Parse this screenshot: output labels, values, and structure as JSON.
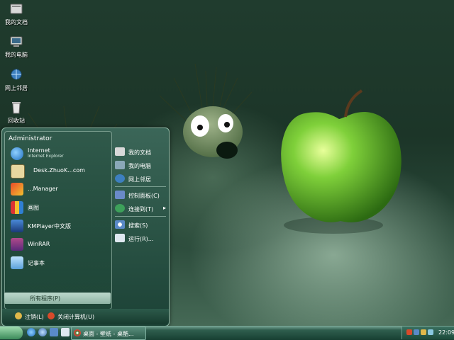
{
  "desktop": {
    "icons": [
      {
        "label": "我的文档",
        "icon": "my-documents-icon"
      },
      {
        "label": "我的电脑",
        "icon": "my-computer-icon"
      },
      {
        "label": "网上邻居",
        "icon": "network-places-icon"
      },
      {
        "label": "回收站",
        "icon": "recycle-bin-icon"
      }
    ]
  },
  "start_menu": {
    "user": "Administrator",
    "programs": [
      {
        "label": "Internet",
        "sublabel": "Internet Explorer",
        "icon": "internet-explorer-icon"
      },
      {
        "label": "Desk.ZhuoK...com",
        "icon": "website-icon"
      },
      {
        "label": "...Manager",
        "icon": "manager-icon"
      },
      {
        "label": "画图",
        "icon": "paint-icon"
      },
      {
        "label": "KMPlayer中文版",
        "icon": "kmplayer-icon"
      },
      {
        "label": "WinRAR",
        "icon": "winrar-icon"
      },
      {
        "label": "记事本",
        "icon": "notepad-icon"
      }
    ],
    "all_programs": "所有程序(P)",
    "right_items": [
      {
        "label": "我的文档",
        "icon": "my-documents-icon"
      },
      {
        "label": "我的电脑",
        "icon": "my-computer-icon"
      },
      {
        "label": "网上邻居",
        "icon": "network-places-icon"
      },
      {
        "label": "控制面板(C)",
        "icon": "control-panel-icon"
      },
      {
        "label": "连接到(T)",
        "icon": "connect-to-icon",
        "arrow": "▸"
      },
      {
        "label": "搜索(S)",
        "icon": "search-icon"
      },
      {
        "label": "运行(R)...",
        "icon": "run-icon"
      }
    ],
    "logoff": "注销(L)",
    "shutdown": "关闭计算机(U)"
  },
  "taskbar": {
    "task_label": "桌面 - 壁纸 - 桌酷...",
    "clock": "22:09"
  },
  "colors": {
    "accent": "#2f5e4e",
    "apple": "#6fbf2a"
  }
}
